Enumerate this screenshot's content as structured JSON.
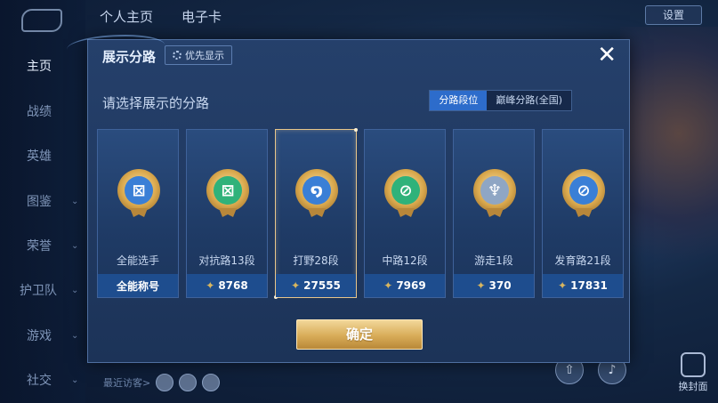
{
  "background": {
    "tabs": [
      "个人主页",
      "电子卡"
    ],
    "settings_label": "设置",
    "sidebar": [
      {
        "label": "主页",
        "active": true
      },
      {
        "label": "战绩",
        "active": false
      },
      {
        "label": "英雄",
        "active": false
      },
      {
        "label": "图鉴",
        "active": false
      },
      {
        "label": "荣誉",
        "active": false
      },
      {
        "label": "护卫队",
        "active": false
      },
      {
        "label": "游戏",
        "active": false
      },
      {
        "label": "社交",
        "active": false
      }
    ],
    "recent_visitors_label": "最近访客>",
    "cover_label": "换封面"
  },
  "dialog": {
    "title": "展示分路",
    "priority_label": "优先显示",
    "close_icon": "close-icon",
    "subtitle": "请选择展示的分路",
    "toggle": [
      "分路段位",
      "巅峰分路(全国)"
    ],
    "toggle_active_index": 0,
    "confirm_label": "确定"
  },
  "cards": [
    {
      "label": "全能选手",
      "footer": "全能称号",
      "score": "",
      "icon": "allround-badge-icon",
      "color": "#3a7fd6",
      "selected": false
    },
    {
      "label": "对抗路13段",
      "footer": "8768",
      "score": "8768",
      "icon": "clash-lane-badge-icon",
      "color": "#2fb27a",
      "selected": false
    },
    {
      "label": "打野28段",
      "footer": "27555",
      "score": "27555",
      "icon": "jungle-badge-icon",
      "color": "#3a7fd6",
      "selected": true
    },
    {
      "label": "中路12段",
      "footer": "7969",
      "score": "7969",
      "icon": "mid-lane-badge-icon",
      "color": "#2fb27a",
      "selected": false
    },
    {
      "label": "游走1段",
      "footer": "370",
      "score": "370",
      "icon": "roam-badge-icon",
      "color": "#8fa6c4",
      "selected": false
    },
    {
      "label": "发育路21段",
      "footer": "17831",
      "score": "17831",
      "icon": "farm-lane-badge-icon",
      "color": "#3a7fd6",
      "selected": false
    }
  ]
}
